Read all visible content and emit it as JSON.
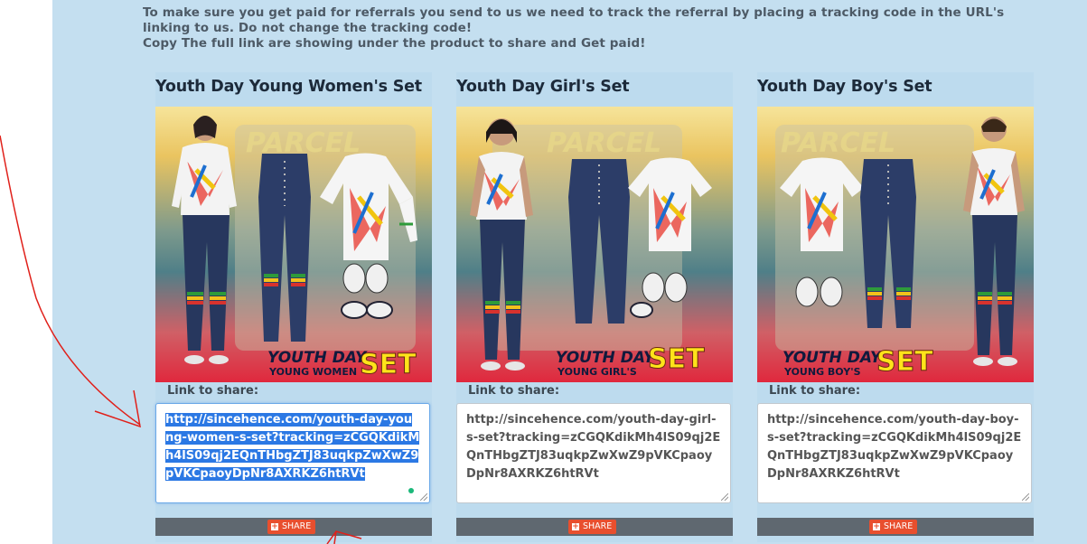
{
  "notice": {
    "line1": "To make sure you get paid for referrals you send to us we need to track the referral by placing a tracking code in the URL's linking to us. Do not change the tracking code!",
    "line2": "Copy The full link are showing under the product to share and Get paid!"
  },
  "products": [
    {
      "title": "Youth Day Young Women's Set",
      "image_caption_top": "YOUTH DAY",
      "image_caption_sub": "YOUNG WOMEN",
      "image_caption_set": "SET",
      "link_label": "Link to share:",
      "link": "http://sincehence.com/youth-day-young-women-s-set?tracking=zCGQKdikMh4lS09qj2EQnTHbgZTJ83uqkpZwXwZ9pVKCpaoyDpNr8AXRKZ6htRVt",
      "share_label": "SHARE",
      "selected": true
    },
    {
      "title": "Youth Day Girl's Set",
      "image_caption_top": "YOUTH DAY",
      "image_caption_sub": "YOUNG GIRL'S",
      "image_caption_set": "SET",
      "link_label": "Link to share:",
      "link": "http://sincehence.com/youth-day-girl-s-set?tracking=zCGQKdikMh4lS09qj2EQnTHbgZTJ83uqkpZwXwZ9pVKCpaoyDpNr8AXRKZ6htRVt",
      "share_label": "SHARE",
      "selected": false
    },
    {
      "title": "Youth Day Boy's Set",
      "image_caption_top": "YOUTH DAY",
      "image_caption_sub": "YOUNG BOY'S",
      "image_caption_set": "SET",
      "link_label": "Link to share:",
      "link": "http://sincehence.com/youth-day-boy-s-set?tracking=zCGQKdikMh4lS09qj2EQnTHbgZTJ83uqkpZwXwZ9pVKCpaoyDpNr8AXRKZ6htRVt",
      "share_label": "SHARE",
      "selected": false
    }
  ],
  "colors": {
    "panel_bg": "#c4dff0",
    "share_button": "#e84f2e",
    "share_bar": "#5f6870",
    "selection": "#2b78e4",
    "annotation_arrow": "#e0201a"
  },
  "icons": [
    "plus-icon",
    "annotation-arrow",
    "resize-grip-icon"
  ]
}
